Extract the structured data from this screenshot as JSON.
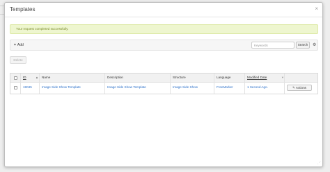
{
  "modal": {
    "title": "Templates",
    "close_glyph": "×"
  },
  "alert": {
    "message": "Your request completed successfully."
  },
  "toolbar": {
    "add_label": "Add",
    "search_placeholder": "Keywords",
    "search_label": "Search",
    "options_icon": "gear-icon"
  },
  "actions": {
    "delete_label": "Delete"
  },
  "table": {
    "columns": [
      "ID",
      "Name",
      "Description",
      "Structure",
      "Language",
      "Modified Date"
    ],
    "rows": [
      {
        "id": "19045",
        "name": "Image Side Show Template",
        "description": "Image Side Show Template",
        "structure": "Image Side Show",
        "language": "FreeMarker",
        "modified_date": "1 Second Ago.",
        "actions_label": "Actions"
      }
    ]
  },
  "colors": {
    "alert_bg": "#eef6cf",
    "alert_text": "#7a8c2a",
    "link": "#2a6fc9",
    "header_bg": "#f1f1f1"
  }
}
